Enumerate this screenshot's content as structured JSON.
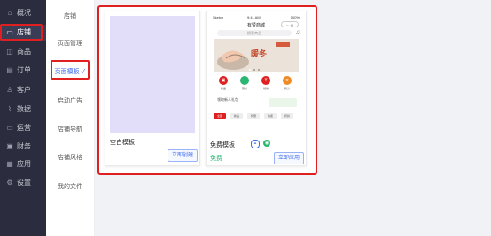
{
  "nav": {
    "items": [
      {
        "label": "概况",
        "icon": "home-icon",
        "glyph": "⌂"
      },
      {
        "label": "店铺",
        "icon": "store-icon",
        "glyph": "▭",
        "active": true
      },
      {
        "label": "商品",
        "icon": "goods-icon",
        "glyph": "◫"
      },
      {
        "label": "订单",
        "icon": "order-icon",
        "glyph": "▤"
      },
      {
        "label": "客户",
        "icon": "customer-icon",
        "glyph": "♙"
      },
      {
        "label": "数据",
        "icon": "chart-icon",
        "glyph": "⌇"
      },
      {
        "label": "运营",
        "icon": "ops-icon",
        "glyph": "▭"
      },
      {
        "label": "财务",
        "icon": "finance-icon",
        "glyph": "▣"
      },
      {
        "label": "应用",
        "icon": "apps-icon",
        "glyph": "▦"
      },
      {
        "label": "设置",
        "icon": "settings-icon",
        "glyph": "⚙"
      }
    ]
  },
  "sub": {
    "items": [
      {
        "label": "店铺"
      },
      {
        "label": "页面管理"
      },
      {
        "label": "页面模板 ✓",
        "active": true
      },
      {
        "label": "启动广告"
      },
      {
        "label": "店铺导航"
      },
      {
        "label": "店铺风格"
      },
      {
        "label": "我的文件"
      }
    ]
  },
  "templates": {
    "blank": {
      "title": "空白模板",
      "button": "立即创建"
    },
    "free": {
      "title": "免费模板",
      "price": "免费",
      "button": "立即应用"
    }
  },
  "phone": {
    "carrier": "Sketch",
    "time": "9:41 AM",
    "battery": "100%",
    "title": "有赞商城",
    "capsule": "··· ◎",
    "search_placeholder": "搜索商品",
    "banner_text": "暖冬",
    "gift_text": "领取新人礼包",
    "icons": [
      "新品",
      "限时",
      "领券",
      "积分"
    ],
    "tabs": [
      "全部",
      "新品",
      "特惠",
      "热卖",
      "折扣"
    ]
  },
  "colors": {
    "accent": "#3f6cf0",
    "highlight": "#e02020",
    "nav_bg": "#2b2d3e"
  }
}
